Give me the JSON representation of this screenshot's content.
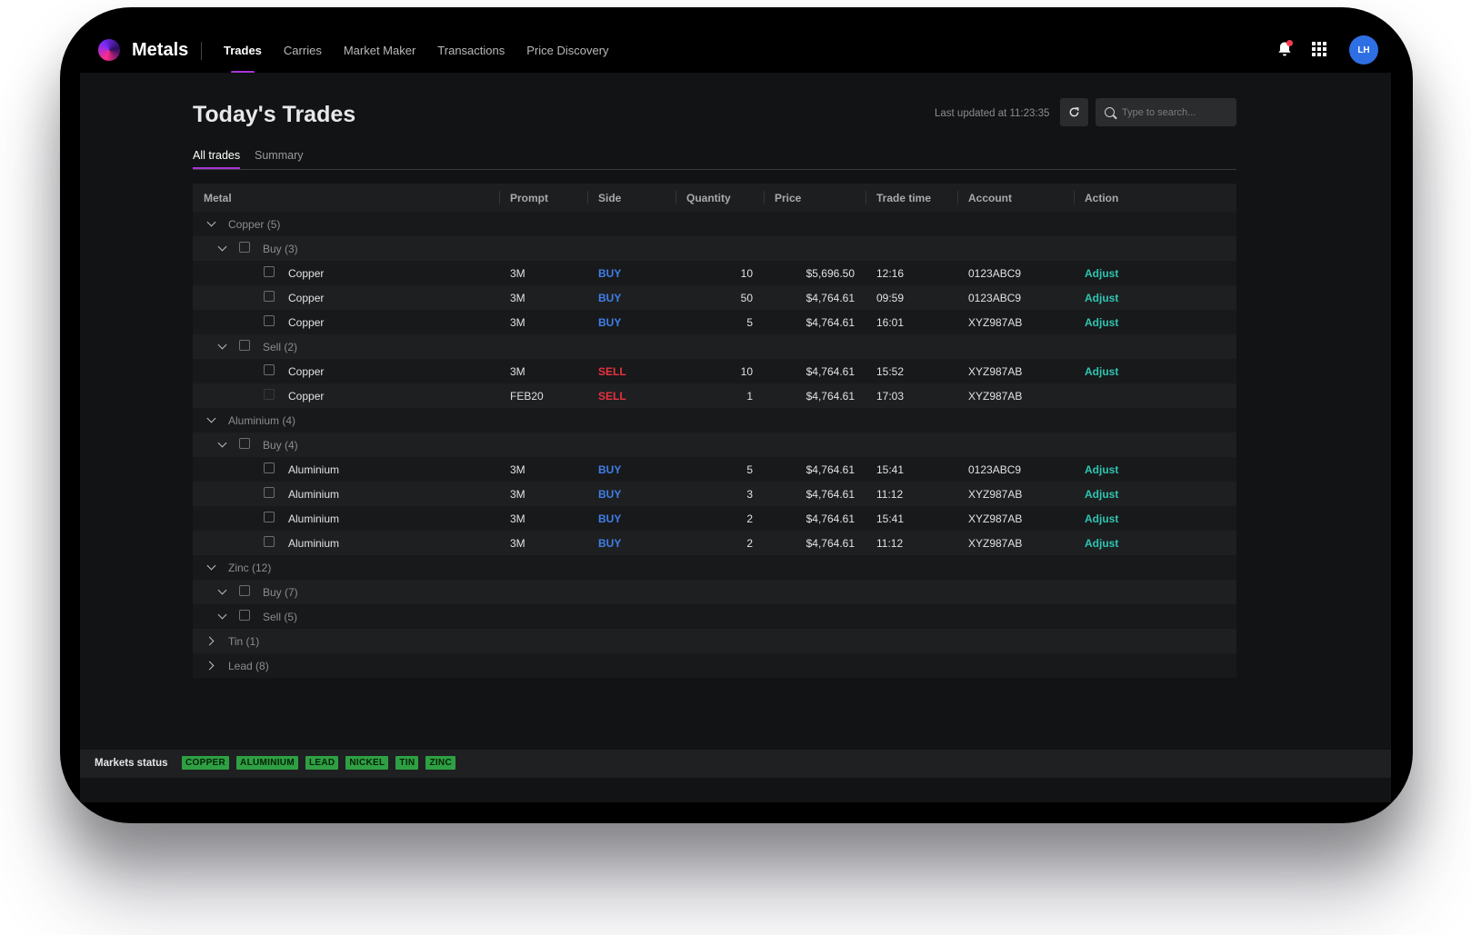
{
  "nav": {
    "brand": "Metals",
    "links": [
      {
        "label": "Trades",
        "active": true
      },
      {
        "label": "Carries",
        "active": false
      },
      {
        "label": "Market Maker",
        "active": false
      },
      {
        "label": "Transactions",
        "active": false
      },
      {
        "label": "Price Discovery",
        "active": false
      }
    ],
    "avatar_initials": "LH",
    "icons": [
      "bell-icon",
      "apps-grid-icon"
    ]
  },
  "header": {
    "title": "Today's Trades",
    "last_updated": "Last updated at 11:23:35",
    "search_placeholder": "Type to search..."
  },
  "tabs": [
    {
      "label": "All trades",
      "active": true
    },
    {
      "label": "Summary",
      "active": false
    }
  ],
  "table": {
    "columns": [
      "Metal",
      "Prompt",
      "Side",
      "Quantity",
      "Price",
      "Trade time",
      "Account",
      "Action"
    ],
    "rows": [
      {
        "type": "group",
        "level": 0,
        "expanded": true,
        "label": "Copper (5)"
      },
      {
        "type": "group",
        "level": 1,
        "expanded": true,
        "label": "Buy (3)"
      },
      {
        "type": "trade",
        "metal": "Copper",
        "prompt": "3M",
        "side": "BUY",
        "quantity": "10",
        "price": "$5,696.50",
        "time": "12:16",
        "account": "0123ABC9",
        "action": "Adjust"
      },
      {
        "type": "trade",
        "metal": "Copper",
        "prompt": "3M",
        "side": "BUY",
        "quantity": "50",
        "price": "$4,764.61",
        "time": "09:59",
        "account": "0123ABC9",
        "action": "Adjust"
      },
      {
        "type": "trade",
        "metal": "Copper",
        "prompt": "3M",
        "side": "BUY",
        "quantity": "5",
        "price": "$4,764.61",
        "time": "16:01",
        "account": "XYZ987AB",
        "action": "Adjust"
      },
      {
        "type": "group",
        "level": 1,
        "expanded": true,
        "label": "Sell (2)"
      },
      {
        "type": "trade",
        "metal": "Copper",
        "prompt": "3M",
        "side": "SELL",
        "quantity": "10",
        "price": "$4,764.61",
        "time": "15:52",
        "account": "XYZ987AB",
        "action": "Adjust"
      },
      {
        "type": "trade",
        "metal": "Copper",
        "prompt": "FEB20",
        "side": "SELL",
        "quantity": "1",
        "price": "$4,764.61",
        "time": "17:03",
        "account": "XYZ987AB",
        "action": "",
        "disabled": true
      },
      {
        "type": "group",
        "level": 0,
        "expanded": true,
        "label": "Aluminium (4)"
      },
      {
        "type": "group",
        "level": 1,
        "expanded": true,
        "label": "Buy (4)"
      },
      {
        "type": "trade",
        "metal": "Aluminium",
        "prompt": "3M",
        "side": "BUY",
        "quantity": "5",
        "price": "$4,764.61",
        "time": "15:41",
        "account": "0123ABC9",
        "action": "Adjust"
      },
      {
        "type": "trade",
        "metal": "Aluminium",
        "prompt": "3M",
        "side": "BUY",
        "quantity": "3",
        "price": "$4,764.61",
        "time": "11:12",
        "account": "XYZ987AB",
        "action": "Adjust"
      },
      {
        "type": "trade",
        "metal": "Aluminium",
        "prompt": "3M",
        "side": "BUY",
        "quantity": "2",
        "price": "$4,764.61",
        "time": "15:41",
        "account": "XYZ987AB",
        "action": "Adjust"
      },
      {
        "type": "trade",
        "metal": "Aluminium",
        "prompt": "3M",
        "side": "BUY",
        "quantity": "2",
        "price": "$4,764.61",
        "time": "11:12",
        "account": "XYZ987AB",
        "action": "Adjust"
      },
      {
        "type": "group",
        "level": 0,
        "expanded": true,
        "label": "Zinc (12)"
      },
      {
        "type": "group",
        "level": 1,
        "expanded": true,
        "label": "Buy (7)"
      },
      {
        "type": "group",
        "level": 1,
        "expanded": true,
        "label": "Sell (5)"
      },
      {
        "type": "group",
        "level": 0,
        "expanded": false,
        "label": "Tin (1)"
      },
      {
        "type": "group",
        "level": 0,
        "expanded": false,
        "label": "Lead (8)"
      }
    ]
  },
  "status": {
    "label": "Markets status",
    "markets": [
      "COPPER",
      "ALUMINIUM",
      "LEAD",
      "NICKEL",
      "TIN",
      "ZINC"
    ],
    "badge_color": "#2ea043"
  },
  "colors": {
    "accent": "#a635d6",
    "buy": "#3f7fe8",
    "sell": "#e8323f",
    "action": "#2ec5b2",
    "avatar": "#2f6fe4"
  }
}
